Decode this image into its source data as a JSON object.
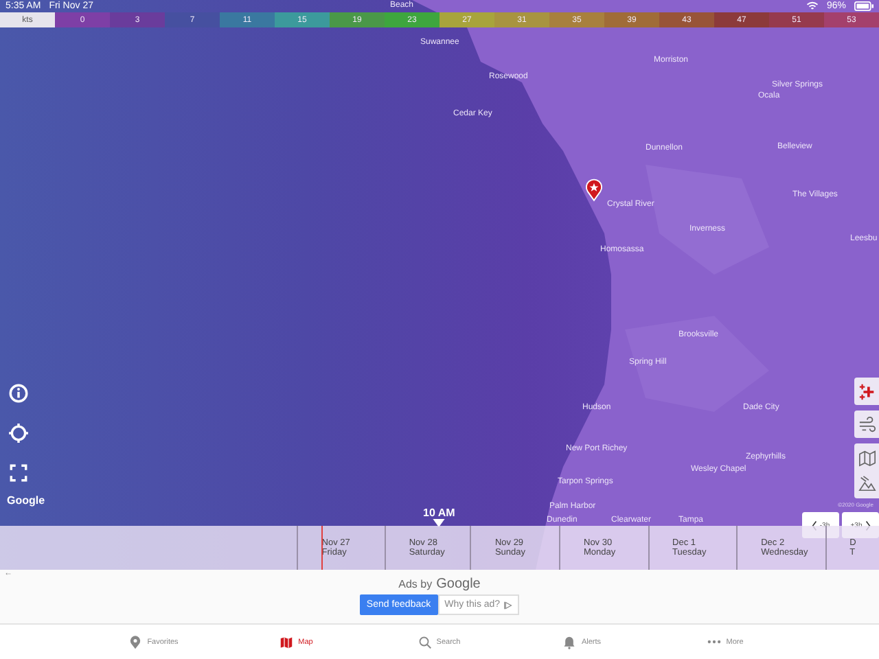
{
  "status_bar": {
    "time": "5:35 AM",
    "date": "Fri Nov 27",
    "battery": "96%"
  },
  "legend": {
    "unit": "kts",
    "steps": [
      {
        "label": "0",
        "color": "#7e3fa6"
      },
      {
        "label": "3",
        "color": "#6a3c9c"
      },
      {
        "label": "7",
        "color": "#4650a0"
      },
      {
        "label": "11",
        "color": "#3a78a0"
      },
      {
        "label": "15",
        "color": "#3c9a9c"
      },
      {
        "label": "19",
        "color": "#4a9848"
      },
      {
        "label": "23",
        "color": "#3ea63e"
      },
      {
        "label": "27",
        "color": "#a8a43c"
      },
      {
        "label": "31",
        "color": "#a89440"
      },
      {
        "label": "35",
        "color": "#a8803e"
      },
      {
        "label": "39",
        "color": "#a06c38"
      },
      {
        "label": "43",
        "color": "#985438"
      },
      {
        "label": "47",
        "color": "#8c3a3a"
      },
      {
        "label": "51",
        "color": "#963a4e"
      },
      {
        "label": "53",
        "color": "#a4406c"
      }
    ]
  },
  "map": {
    "labels": [
      "Beach",
      "Suwannee",
      "Rosewood",
      "Cedar Key",
      "Morriston",
      "Silver Springs",
      "Ocala",
      "Dunnellon",
      "Belleview",
      "Crystal River",
      "The Villages",
      "Inverness",
      "Leesbu",
      "Homosassa",
      "Brooksville",
      "Spring Hill",
      "Hudson",
      "Dade City",
      "New Port Richey",
      "Zephyrhills",
      "Wesley Chapel",
      "Tarpon Springs",
      "Palm Harbor",
      "Dunedin",
      "Clearwater",
      "Tampa"
    ],
    "logo": "Google",
    "copyright": "©2020 Google"
  },
  "timeline": {
    "current_time": "10 AM",
    "days": [
      {
        "date": "Nov 27",
        "weekday": "Friday"
      },
      {
        "date": "Nov 28",
        "weekday": "Saturday"
      },
      {
        "date": "Nov 29",
        "weekday": "Sunday"
      },
      {
        "date": "Nov 30",
        "weekday": "Monday"
      },
      {
        "date": "Dec 1",
        "weekday": "Tuesday"
      },
      {
        "date": "Dec 2",
        "weekday": "Wednesday"
      },
      {
        "date": "D",
        "weekday": "T"
      }
    ],
    "step_back": "-3h",
    "step_forward": "+3h"
  },
  "ad": {
    "back": "←",
    "ads_by": "Ads by",
    "brand": "Google",
    "feedback": "Send feedback",
    "why": "Why this ad?"
  },
  "tabs": [
    {
      "label": "Favorites",
      "selected": false
    },
    {
      "label": "Map",
      "selected": true
    },
    {
      "label": "Search",
      "selected": false
    },
    {
      "label": "Alerts",
      "selected": false
    },
    {
      "label": "More",
      "selected": false
    }
  ]
}
